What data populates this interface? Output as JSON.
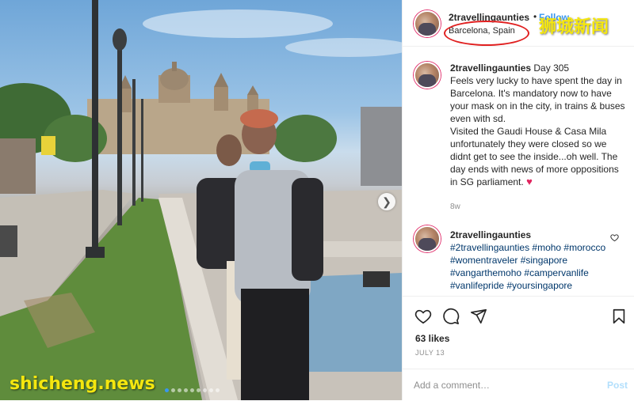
{
  "post": {
    "username": "2travellingaunties",
    "separator": "•",
    "follow_label": "Follow",
    "location": "Barcelona, Spain"
  },
  "watermarks": {
    "top_right": "狮城新闻",
    "bottom_left": "shicheng.news"
  },
  "caption": {
    "username": "2travellingaunties",
    "first_line": "Day 305",
    "lines": [
      "Feels very lucky to have spent the day in Barcelona. It's mandatory now to have your mask on in the city, in trains & buses even with sd.",
      "Visited the Gaudi House & Casa Mila unfortunately they were closed so we didnt get to see the inside...oh well. The day ends with news of more oppositions in SG parliament."
    ],
    "emoji": "♥",
    "time": "8w"
  },
  "comment": {
    "username": "2travellingaunties",
    "tags": "#2travellingaunties #moho #morocco #womentraveler #singapore #vangarthemoho #campervanlife #vanlifepride #yoursingapore"
  },
  "actions": {
    "likes": "63 likes",
    "date": "JULY 13"
  },
  "add_comment": {
    "placeholder": "Add a comment…",
    "post_label": "Post"
  },
  "carousel": {
    "total": 9,
    "active_index": 0
  },
  "icons": [
    "heart-icon",
    "comment-icon",
    "share-icon",
    "bookmark-icon",
    "chevron-right-icon"
  ],
  "colors": {
    "link": "#3897f0",
    "hashtag": "#00376b",
    "highlight_circle": "#e02020",
    "watermark": "#f4e60f"
  }
}
